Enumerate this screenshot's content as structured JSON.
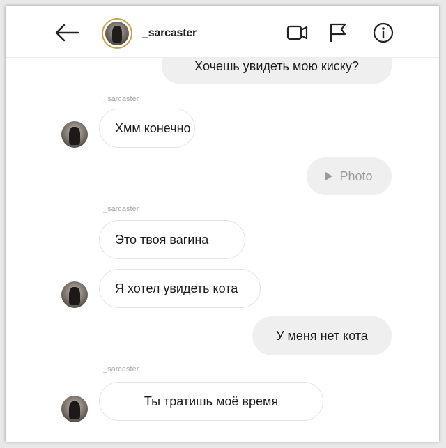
{
  "header": {
    "username": "_sarcaster",
    "icons": [
      "back-arrow-icon",
      "profile-avatar",
      "video-call-icon",
      "flag-icon",
      "info-icon"
    ]
  },
  "messages": [
    {
      "direction": "outgoing",
      "text": "Хочешь увидеть мою киску?"
    },
    {
      "direction": "incoming",
      "sender": "_sarcaster",
      "text": "Хмм конечно"
    },
    {
      "direction": "outgoing",
      "type": "photo",
      "text": "Photo"
    },
    {
      "direction": "incoming",
      "sender": "_sarcaster",
      "text": "Это твоя вагина"
    },
    {
      "direction": "incoming",
      "text": "Я хотел увидеть кота"
    },
    {
      "direction": "outgoing",
      "text": "У меня нет кота"
    },
    {
      "direction": "incoming",
      "sender": "_sarcaster",
      "text": "Ты тратишь моё время"
    }
  ]
}
